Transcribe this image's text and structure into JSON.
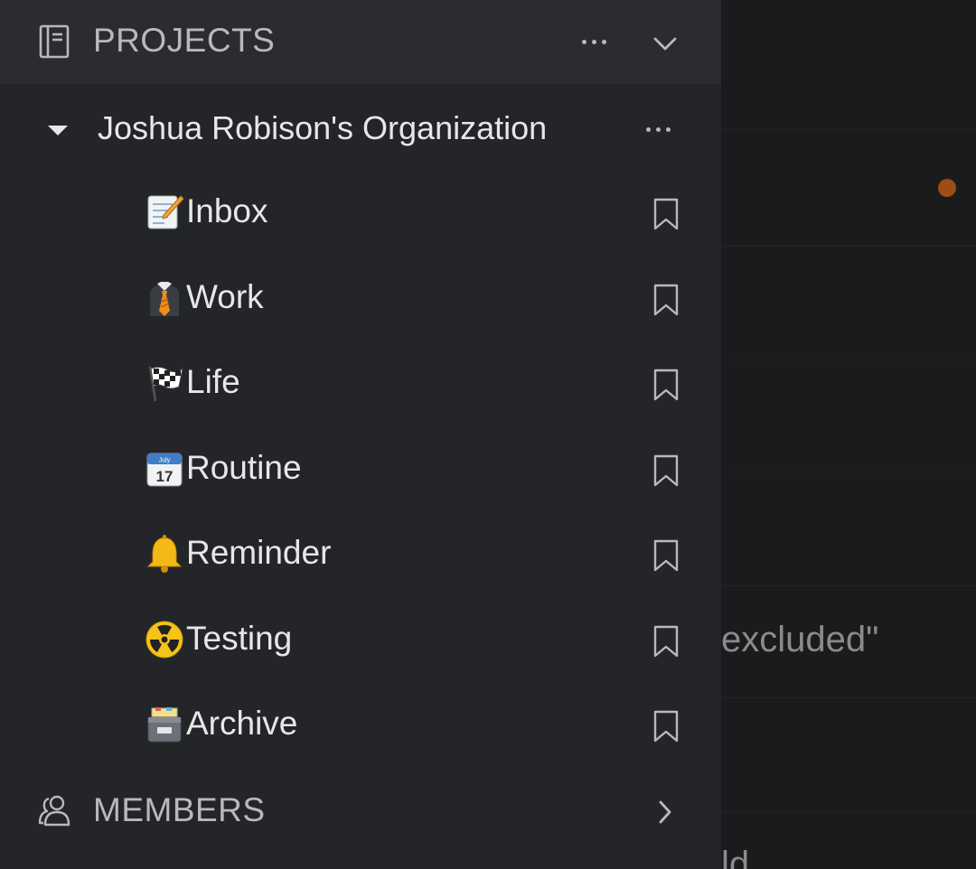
{
  "sidebar": {
    "projects_header": {
      "title": "PROJECTS",
      "icon": "notebook-icon"
    },
    "organization": {
      "name": "Joshua Robison's Organization"
    },
    "projects": [
      {
        "label": "Inbox",
        "emoji": "📝",
        "icon": "memo-icon"
      },
      {
        "label": "Work",
        "emoji": "👔",
        "icon": "necktie-icon"
      },
      {
        "label": "Life",
        "emoji": "🏁",
        "icon": "checkered-flag-icon"
      },
      {
        "label": "Routine",
        "emoji": "📆",
        "icon": "calendar-icon"
      },
      {
        "label": "Reminder",
        "emoji": "🔔",
        "icon": "bell-icon"
      },
      {
        "label": "Testing",
        "emoji": "☢️",
        "icon": "radioactive-icon"
      },
      {
        "label": "Archive",
        "emoji": "🗃️",
        "icon": "card-file-box-icon"
      }
    ],
    "members_header": {
      "title": "MEMBERS",
      "icon": "people-icon"
    }
  },
  "background": {
    "visible_text": "excluded\"",
    "partial_text": "ld"
  },
  "colors": {
    "drawer_bg": "#242528",
    "header_bg": "#2b2c2f",
    "backdrop_bg": "#1a1b1d",
    "accent_dot": "#a04c16"
  }
}
